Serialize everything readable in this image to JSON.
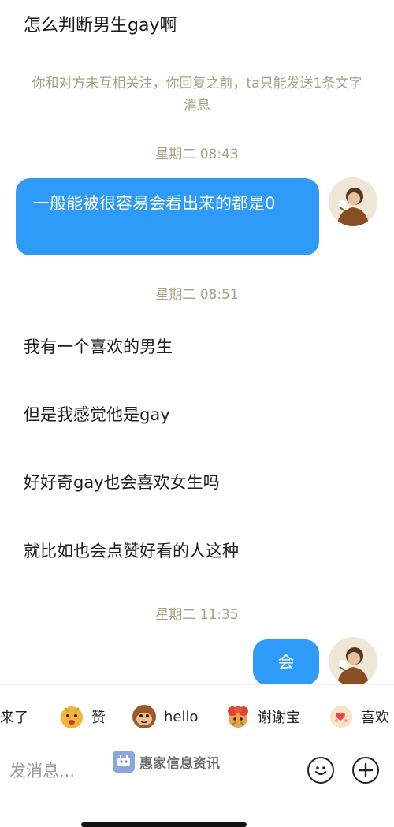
{
  "chat": {
    "first_message": "怎么判断男生gay啊",
    "notice_line1": "你和对方未互相关注，你回复之前，ta只能发送1条文字",
    "notice_line2": "消息",
    "timestamp_1": "星期二 08:43",
    "outgoing_1": "一般能被很容易会看出来的都是0",
    "timestamp_2": "星期二 08:51",
    "incoming": [
      "我有一个喜欢的男生",
      "但是我感觉他是gay",
      "好好奇gay也会喜欢女生吗",
      "就比如也会点赞好看的人这种"
    ],
    "timestamp_3": "星期二 11:35",
    "outgoing_2": "会"
  },
  "quick_replies": [
    {
      "label": "来了",
      "icon": "emoji-icon"
    },
    {
      "label": "赞",
      "icon": "thumbs-up-emoji-icon"
    },
    {
      "label": "hello",
      "icon": "monkey-emoji-icon"
    },
    {
      "label": "谢谢宝",
      "icon": "flower-emoji-icon"
    },
    {
      "label": "喜欢",
      "icon": "heart-emoji-icon"
    }
  ],
  "input": {
    "placeholder": "发消息..."
  },
  "watermark": {
    "text": "惠家信息资讯"
  },
  "colors": {
    "bubble_blue": "#2d9bf7",
    "timestamp": "#a89f84"
  }
}
